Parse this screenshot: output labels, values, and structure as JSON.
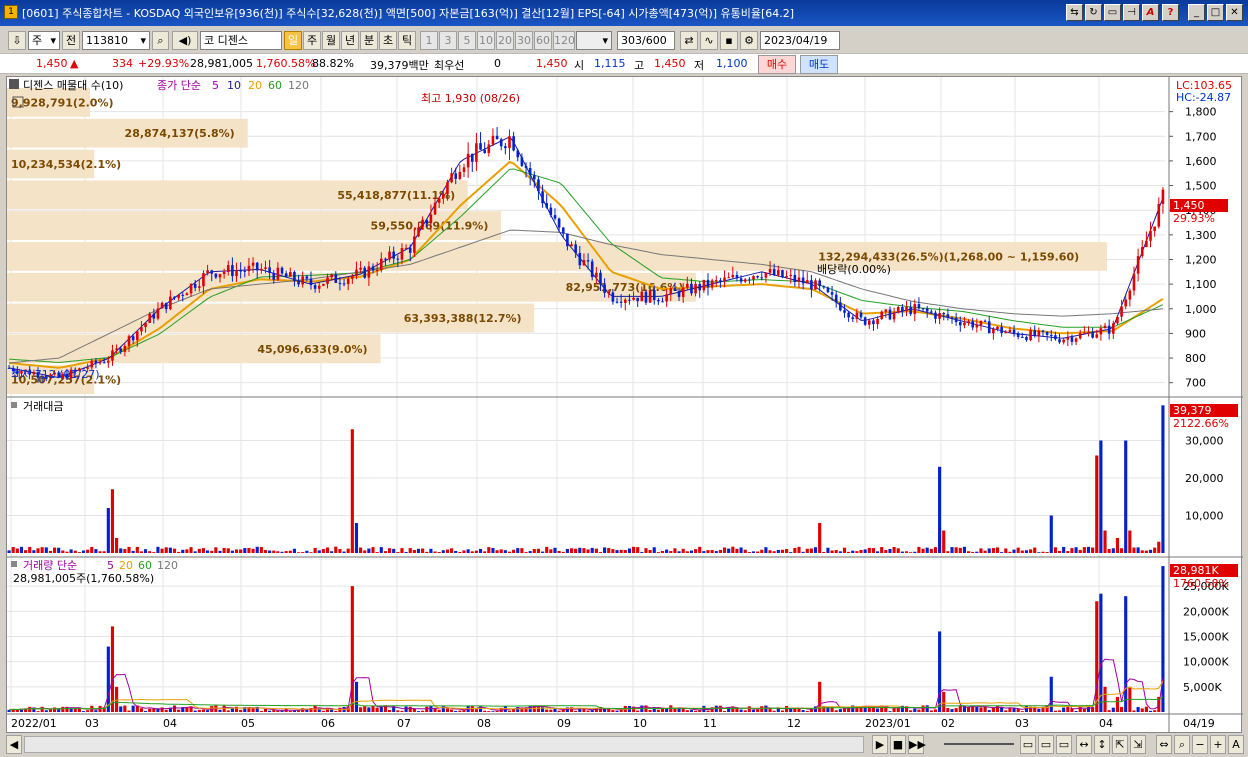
{
  "window": {
    "title": "[0601] 주식종합차트 - KOSDAQ 외국인보유[936(천)] 주식수[32,628(천)] 액면[500] 자본금[163(억)] 결산[12월] EPS[-64] 시가총액[473(억)] 유통비율[64.2]",
    "app_icon": "1",
    "buttons": [
      "link-icon",
      "refresh-icon",
      "window-icon",
      "pin-icon",
      "font-icon",
      "help-icon",
      "minimize-icon",
      "maximize-icon",
      "close-icon"
    ]
  },
  "toolbar": {
    "period_select": "주",
    "prev_label": "전",
    "code_value": "113810",
    "market_prefix": "코",
    "stock_name": "디젠스",
    "period_tabs": [
      "일",
      "주",
      "월",
      "년",
      "분",
      "초",
      "틱"
    ],
    "active_tab": "일",
    "interval_buttons": [
      "1",
      "3",
      "5",
      "10",
      "20",
      "30",
      "60",
      "120"
    ],
    "count_value": "303",
    "count_max": "/600",
    "date_value": "2023/04/19"
  },
  "quote": {
    "price": "1,450",
    "up_arrow": "▲",
    "change": "334",
    "change_pct": "+29.93%",
    "volume": "28,981,005",
    "volume_ratio": "1,760.58%",
    "strength": "88.82%",
    "amount": "39,379백만",
    "bid_label": "최우선",
    "bid_qty": "0",
    "bid_price": "1,450",
    "open_label": "시",
    "open": "1,115",
    "high_label": "고",
    "high": "1,450",
    "low_label": "저",
    "low": "1,100",
    "buy_label": "매수",
    "sell_label": "매도"
  },
  "price_panel": {
    "legend_name": "디젠스 매물대 수(10)",
    "legend_ma_title": "종가 단순",
    "legend_ma": [
      "5",
      "10",
      "20",
      "60",
      "120"
    ],
    "lc_label": "LC:103.65",
    "hc_label": "HC:-24.87",
    "current_price_tag": "1,450",
    "current_pct_tag": "29.93%",
    "high_annotation": "최고 1,930 (08/26)",
    "low_annotation": "최저 712 (01/27)",
    "ex_dividend_label": "배당락(0.00%)",
    "y_ticks": [
      "1,800",
      "1,700",
      "1,600",
      "1,500",
      "1,400",
      "1,300",
      "1,200",
      "1,100",
      "1,000",
      "900",
      "800",
      "700"
    ],
    "volume_profile": [
      "9,928,791(2.0%)",
      "28,874,137(5.8%)",
      "10,234,534(2.1%)",
      "55,418,877(11.1%)",
      "59,550,269(11.9%)",
      "132,294,433(26.5%)(1,268.00 ~ 1,159.60)",
      "82,951,773(16.6%)",
      "63,393,388(12.7%)",
      "45,096,633(9.0%)",
      "10,507,257(2.1%)"
    ]
  },
  "amount_panel": {
    "legend": "거래대금",
    "current_tag": "39,379",
    "current_pct": "2122.66%",
    "y_ticks": [
      "30,000",
      "20,000",
      "10,000"
    ]
  },
  "volume_panel": {
    "legend": "거래량 단순",
    "legend_ma": [
      "5",
      "20",
      "60",
      "120"
    ],
    "sub_legend": "28,981,005주(1,760.58%)",
    "current_tag": "28,981K",
    "current_pct": "1760.58%",
    "y_ticks": [
      "25,000K",
      "20,000K",
      "15,000K",
      "10,000K",
      "5,000K"
    ]
  },
  "x_axis": {
    "labels": [
      "2022/01",
      "03",
      "04",
      "05",
      "06",
      "07",
      "08",
      "09",
      "10",
      "11",
      "12",
      "2023/01",
      "02",
      "03",
      "04"
    ],
    "right_label": "04/19"
  },
  "colors": {
    "up": "#e00000",
    "down": "#0022cc",
    "ma5": "#1a1aa0",
    "ma10": "#3a74c8",
    "ma20": "#e8a000",
    "ma60": "#22a022",
    "ma120": "#777777",
    "profile": "#f5e3c8"
  },
  "chart_data": [
    {
      "type": "candlestick",
      "title": "디젠스 매물대 수(10)",
      "ylim": [
        650,
        1900
      ],
      "x": [
        "2022/01",
        "03",
        "04",
        "05",
        "06",
        "07",
        "08",
        "09",
        "10",
        "11",
        "12",
        "2023/01",
        "02",
        "03",
        "04"
      ],
      "series": [
        {
          "name": "close",
          "values": [
            760,
            720,
            800,
            1000,
            1150,
            1160,
            1100,
            1140,
            1250,
            1600,
            1700,
            1300,
            1050,
            1050,
            1100,
            1150,
            1100,
            950,
            1000,
            950,
            900,
            880,
            920,
            1450
          ]
        },
        {
          "name": "20",
          "values": [
            780,
            760,
            800,
            920,
            1080,
            1120,
            1110,
            1130,
            1200,
            1420,
            1600,
            1420,
            1150,
            1080,
            1090,
            1100,
            1080,
            980,
            990,
            960,
            920,
            900,
            910,
            1040
          ]
        }
      ],
      "volume_profile_pct": [
        2.0,
        5.8,
        2.1,
        11.1,
        11.9,
        26.5,
        16.6,
        12.7,
        9.0,
        2.1
      ]
    },
    {
      "type": "bar",
      "title": "거래대금",
      "ylim": [
        0,
        40000
      ],
      "values": [
        17000,
        33000,
        23000,
        30000,
        30000,
        39379
      ]
    },
    {
      "type": "bar",
      "title": "거래량",
      "ylim": [
        0,
        29000000
      ],
      "values": [
        17000000,
        25000000,
        16000000,
        23000000,
        23500000,
        28981005
      ]
    }
  ]
}
